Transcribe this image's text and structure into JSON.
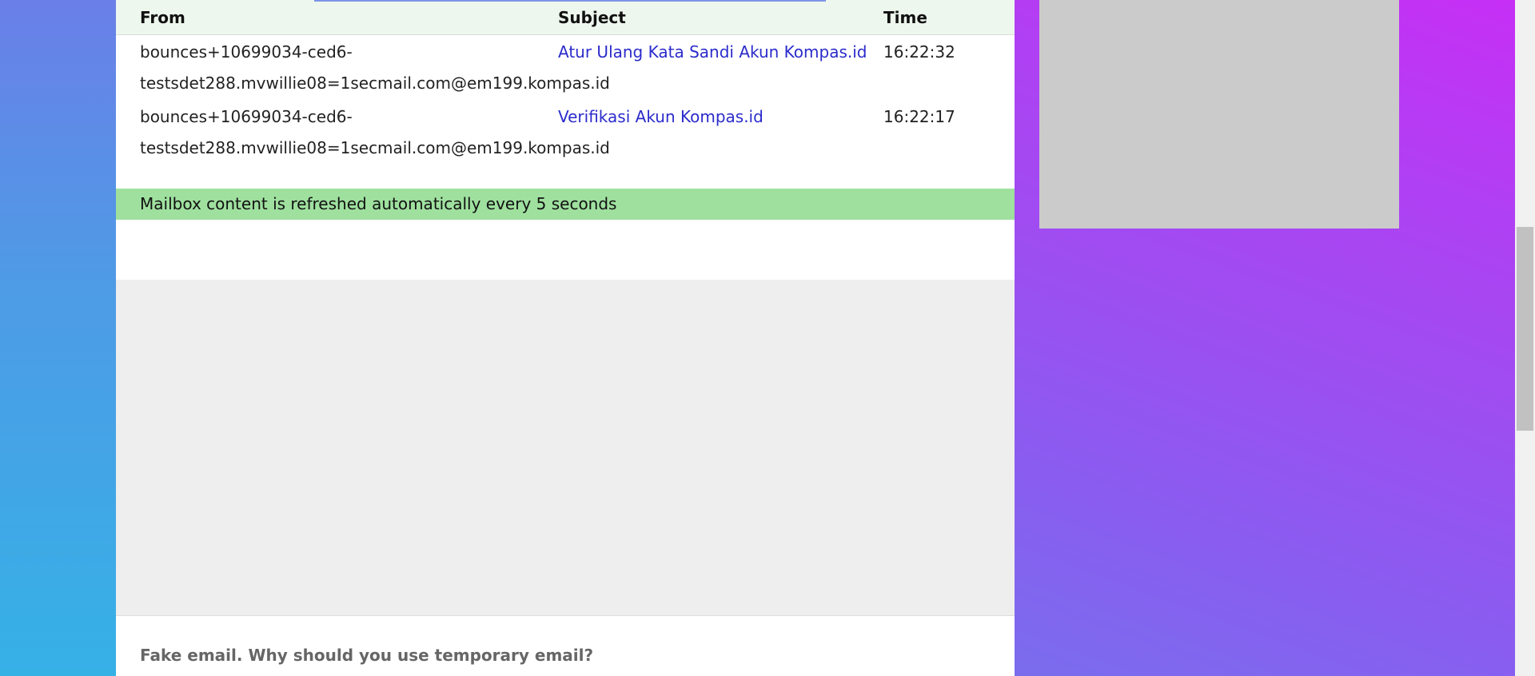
{
  "table": {
    "headers": {
      "from": "From",
      "subject": "Subject",
      "time": "Time"
    },
    "rows": [
      {
        "from": "bounces+10699034-ced6-testsdet288.mvwillie08=1secmail.com@em199.kompas.id",
        "subject": "Atur Ulang Kata Sandi Akun Kompas.id",
        "time": "16:22:32"
      },
      {
        "from": "bounces+10699034-ced6-testsdet288.mvwillie08=1secmail.com@em199.kompas.id",
        "subject": "Verifikasi Akun Kompas.id",
        "time": "16:22:17"
      }
    ]
  },
  "notice": "Mailbox content is refreshed automatically every 5 seconds",
  "faq_title": "Fake email. Why should you use temporary email?",
  "colors": {
    "link": "#2b2bcc",
    "notice_bg": "#9fe09f",
    "header_bg": "#eef7ee"
  }
}
